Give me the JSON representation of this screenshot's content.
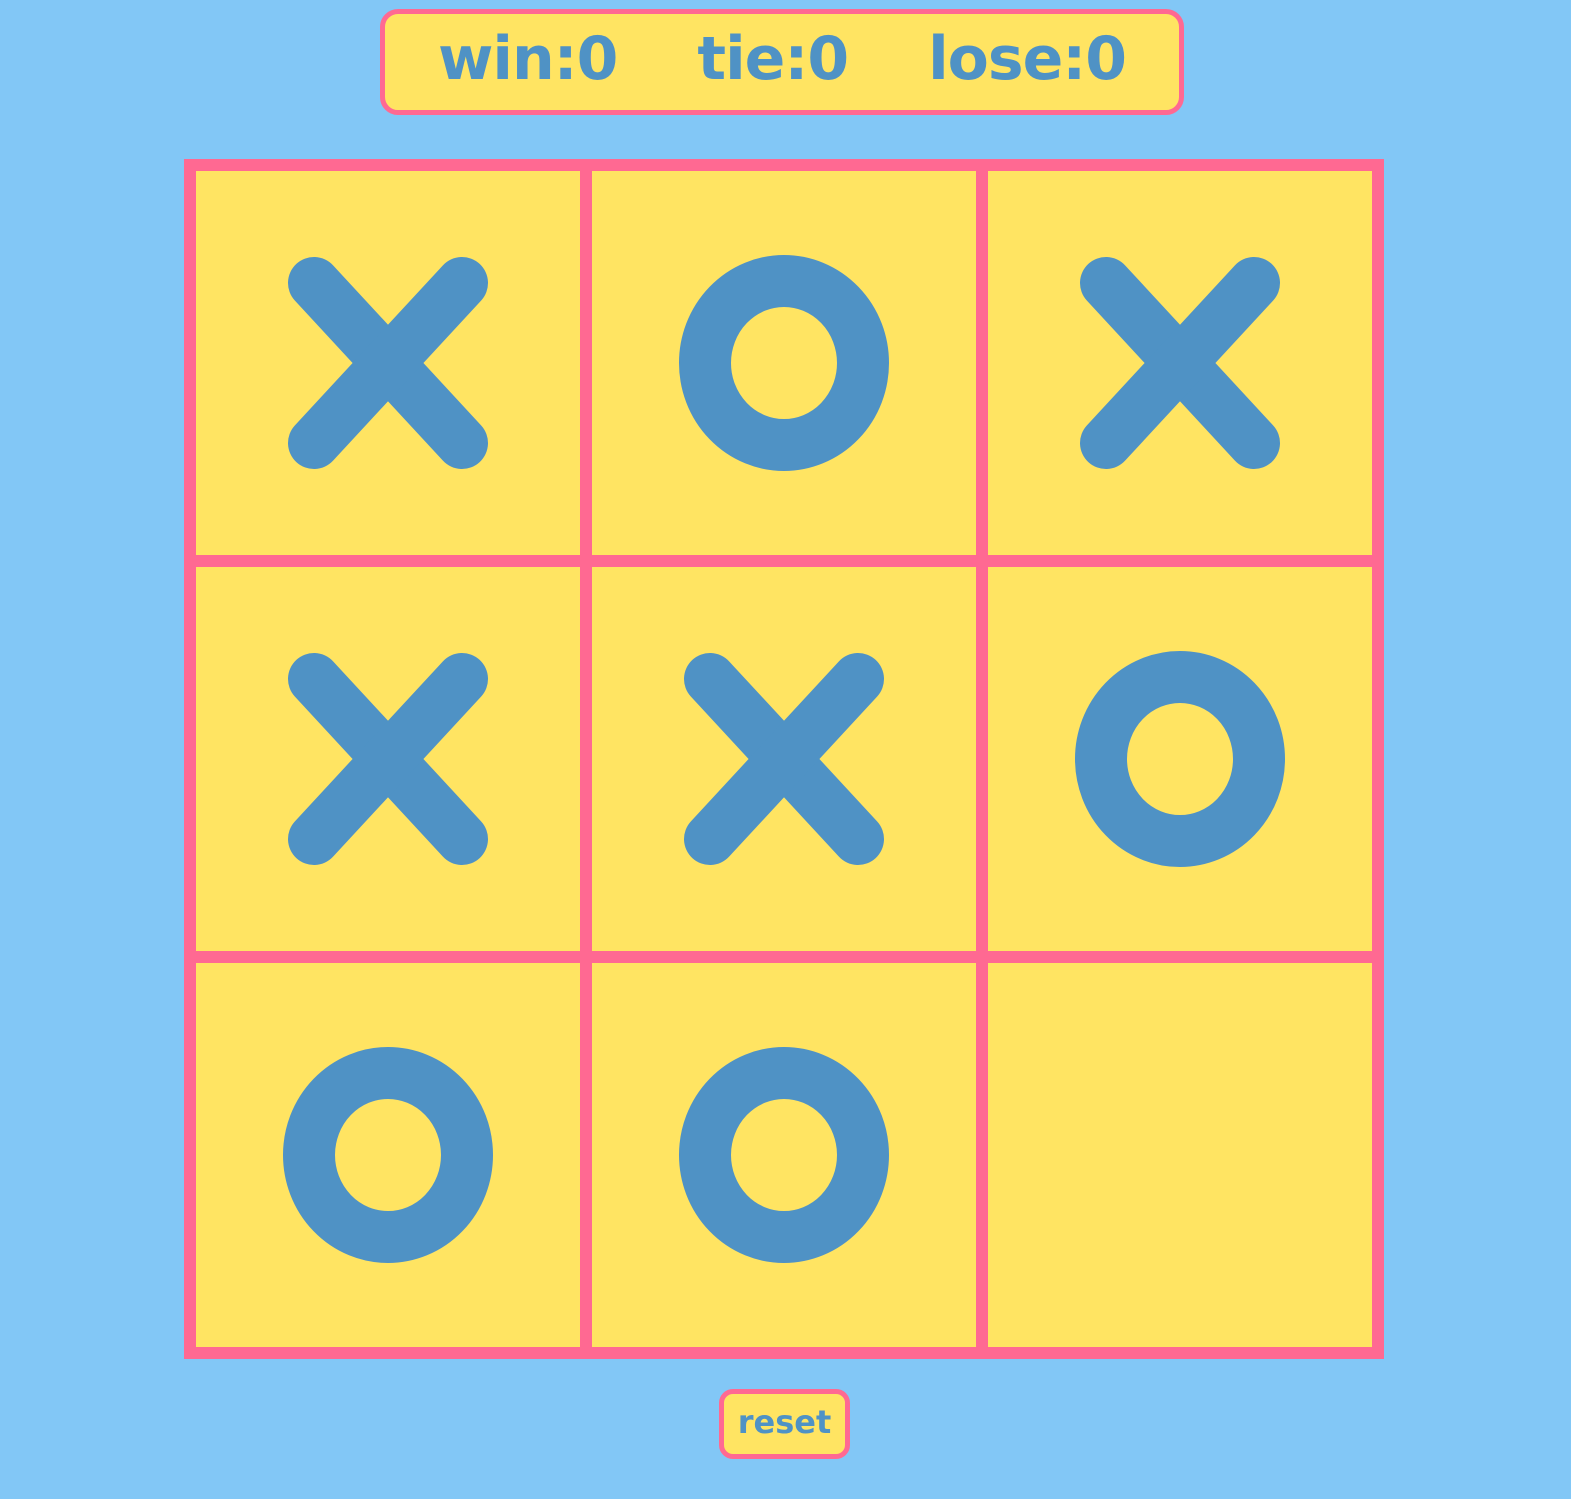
{
  "colors": {
    "background": "#82c7f6",
    "panel": "#ffe462",
    "border": "#ff6992",
    "mark": "#4f92c5"
  },
  "scoreboard": {
    "win": "win:0",
    "tie": "tie:0",
    "lose": "lose:0"
  },
  "board": {
    "cells": [
      "X",
      "O",
      "X",
      "X",
      "X",
      "O",
      "O",
      "O",
      ""
    ]
  },
  "reset_label": "reset"
}
